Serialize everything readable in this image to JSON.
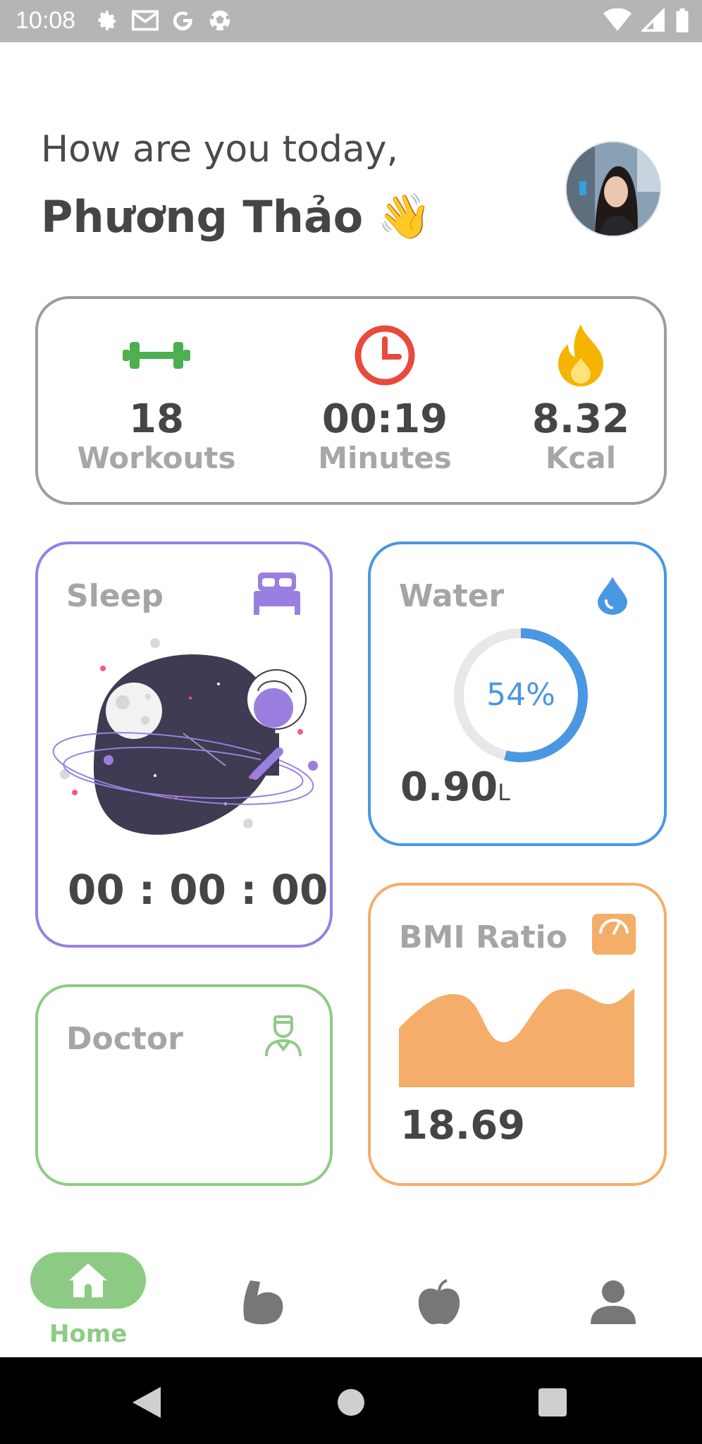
{
  "status_bar": {
    "time": "10:08"
  },
  "greeting": {
    "line": "How are you today,",
    "name": "Phương Thảo",
    "emoji": "👋"
  },
  "summary": {
    "workouts": {
      "value": "18",
      "label": "Workouts",
      "icon": "dumbbell-icon",
      "color": "#4caf50"
    },
    "minutes": {
      "value": "00:19",
      "label": "Minutes",
      "icon": "clock-icon",
      "color": "#e84a3c"
    },
    "kcal": {
      "value": "8.32",
      "label": "Kcal",
      "icon": "flame-icon",
      "color": "#f5b400"
    }
  },
  "cards": {
    "sleep": {
      "title": "Sleep",
      "time": "00 : 00 : 00",
      "icon": "bed-icon",
      "color": "#9a7fe0"
    },
    "water": {
      "title": "Water",
      "percent_label": "54%",
      "progress": 0.54,
      "value": "0.90",
      "unit": "L",
      "icon": "water-drop-icon",
      "color": "#4a97e2"
    },
    "doctor": {
      "title": "Doctor",
      "icon": "doctor-icon",
      "color": "#8fca86"
    },
    "bmi": {
      "title": "BMI Ratio",
      "value": "18.69",
      "icon": "scale-icon",
      "color": "#f4ae69"
    }
  },
  "bottom_nav": {
    "items": [
      {
        "label": "Home",
        "icon": "home-icon",
        "active": true
      },
      {
        "label": "",
        "icon": "arm-muscle-icon",
        "active": false
      },
      {
        "label": "",
        "icon": "apple-icon",
        "active": false
      },
      {
        "label": "",
        "icon": "person-icon",
        "active": false
      }
    ]
  }
}
